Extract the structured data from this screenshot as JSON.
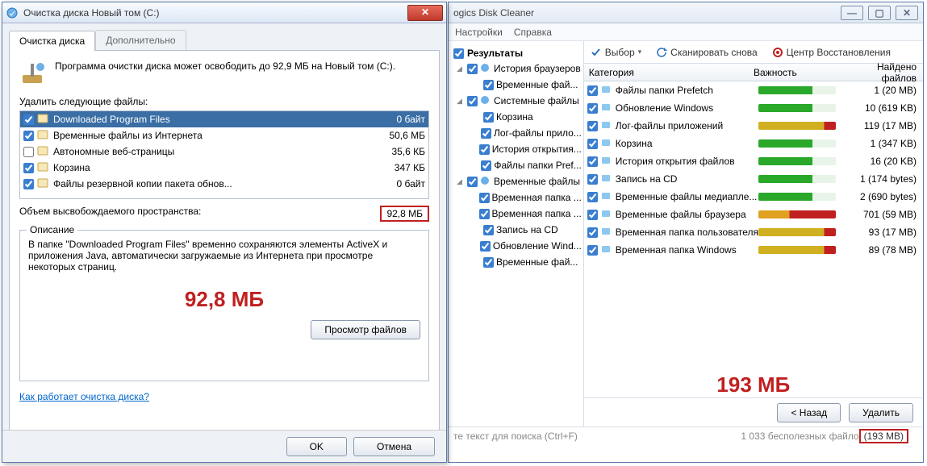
{
  "left": {
    "title": "Очистка диска Новый том (C:)",
    "tabs": {
      "cleanup": "Очистка диска",
      "more": "Дополнительно"
    },
    "intro": "Программа очистки диска может освободить до 92,9 МБ на Новый том (C:).",
    "files_label": "Удалить следующие файлы:",
    "files": [
      {
        "checked": true,
        "name": "Downloaded Program Files",
        "size": "0 байт",
        "selected": true
      },
      {
        "checked": true,
        "name": "Временные файлы из Интернета",
        "size": "50,6 МБ"
      },
      {
        "checked": false,
        "name": "Автономные веб-страницы",
        "size": "35,6 КБ"
      },
      {
        "checked": true,
        "name": "Корзина",
        "size": "347 КБ"
      },
      {
        "checked": true,
        "name": "Файлы резервной копии пакета обнов...",
        "size": "0 байт"
      }
    ],
    "total_label": "Объем высвобождаемого пространства:",
    "total_value": "92,8 МБ",
    "desc_legend": "Описание",
    "desc_text": "В папке \"Downloaded Program Files\" временно сохраняются элементы ActiveX и приложения Java, автоматически загружаемые из Интернета при просмотре некоторых страниц.",
    "big_value": "92,8 МБ",
    "view_files": "Просмотр файлов",
    "how_link": "Как работает очистка диска?",
    "ok": "OK",
    "cancel": "Отмена"
  },
  "right": {
    "title_suffix": "ogics Disk Cleaner",
    "menu": {
      "settings": "Настройки",
      "help": "Справка"
    },
    "tree_header": "Результаты",
    "tree": [
      {
        "depth": 1,
        "arrow": "◢",
        "label": "История браузеров",
        "icon": "globe"
      },
      {
        "depth": 2,
        "arrow": "",
        "label": "Временные фай..."
      },
      {
        "depth": 1,
        "arrow": "◢",
        "label": "Системные файлы",
        "icon": "gear"
      },
      {
        "depth": 2,
        "arrow": "",
        "label": "Корзина"
      },
      {
        "depth": 2,
        "arrow": "",
        "label": "Лог-файлы прило..."
      },
      {
        "depth": 2,
        "arrow": "",
        "label": "История открытия..."
      },
      {
        "depth": 2,
        "arrow": "",
        "label": "Файлы папки Pref..."
      },
      {
        "depth": 1,
        "arrow": "◢",
        "label": "Временные файлы",
        "icon": "folder"
      },
      {
        "depth": 2,
        "arrow": "",
        "label": "Временная папка ..."
      },
      {
        "depth": 2,
        "arrow": "",
        "label": "Временная папка ..."
      },
      {
        "depth": 2,
        "arrow": "",
        "label": "Запись на CD"
      },
      {
        "depth": 2,
        "arrow": "",
        "label": "Обновление Wind..."
      },
      {
        "depth": 2,
        "arrow": "",
        "label": "Временные фай..."
      }
    ],
    "toolbar": {
      "select": "Выбор",
      "rescan": "Сканировать снова",
      "rescue": "Центр Восстановления"
    },
    "columns": {
      "cat": "Категория",
      "imp": "Важность",
      "found": "Найдено файлов"
    },
    "rows": [
      {
        "name": "Файлы папки Prefetch",
        "bar": "green",
        "count": "1 (20 MB)"
      },
      {
        "name": "Обновление Windows",
        "bar": "green",
        "count": "10 (619 KB)"
      },
      {
        "name": "Лог-файлы приложений",
        "bar": "yellow",
        "count": "119 (17 MB)"
      },
      {
        "name": "Корзина",
        "bar": "green",
        "count": "1 (347 KB)"
      },
      {
        "name": "История открытия файлов",
        "bar": "green",
        "count": "16 (20 KB)"
      },
      {
        "name": "Запись на CD",
        "bar": "green",
        "count": "1 (174 bytes)"
      },
      {
        "name": "Временные файлы медиапле...",
        "bar": "green",
        "count": "2 (690 bytes)"
      },
      {
        "name": "Временные файлы браузера",
        "bar": "red",
        "count": "701 (59 MB)"
      },
      {
        "name": "Временная папка пользователя",
        "bar": "yellow",
        "count": "93 (17 MB)"
      },
      {
        "name": "Временная папка Windows",
        "bar": "yellow",
        "count": "89 (78 MB)"
      }
    ],
    "big_value": "193 МБ",
    "back": "< Назад",
    "delete": "Удалить",
    "search_placeholder": "те текст для поиска (Ctrl+F)",
    "status_left": "1 033 бесполезных файло",
    "status_box": "(193 MB)"
  }
}
